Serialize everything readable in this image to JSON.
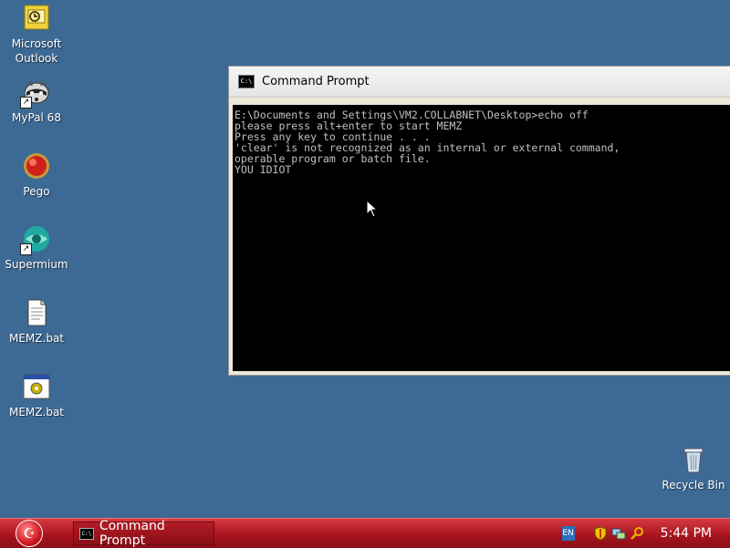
{
  "desktop": {
    "background_color": "#3d6a95",
    "icons": [
      {
        "label": "Microsoft\nOutlook",
        "icon": "outlook-icon"
      },
      {
        "label": "MyPal 68",
        "icon": "mypal-icon"
      },
      {
        "label": "Pego",
        "icon": "pego-icon"
      },
      {
        "label": "Supermium",
        "icon": "supermium-icon"
      },
      {
        "label": "MEMZ.bat",
        "icon": "bat-file-icon"
      },
      {
        "label": "MEMZ.bat",
        "icon": "bat-settings-icon"
      }
    ],
    "recycle_bin": {
      "label": "Recycle Bin",
      "icon": "recycle-bin-icon"
    }
  },
  "cmd_window": {
    "title": "Command Prompt",
    "icon_text": "C:\\",
    "lines": [
      "E:\\Documents and Settings\\VM2.COLLABNET\\Desktop>echo off",
      "please press alt+enter to start MEMZ",
      "Press any key to continue . . .",
      "'clear' is not recognized as an internal or external command,",
      "operable program or batch file.",
      "YOU IDIOT"
    ]
  },
  "taskbar": {
    "color": "#a8151f",
    "start_icon": "start-orb-icon",
    "items": [
      {
        "label": "Command Prompt",
        "icon_text": "C:\\"
      }
    ],
    "tray": {
      "language": "EN",
      "icons": [
        "shield-icon",
        "network-icon",
        "search-key-icon"
      ],
      "clock": "5:44 PM"
    }
  }
}
